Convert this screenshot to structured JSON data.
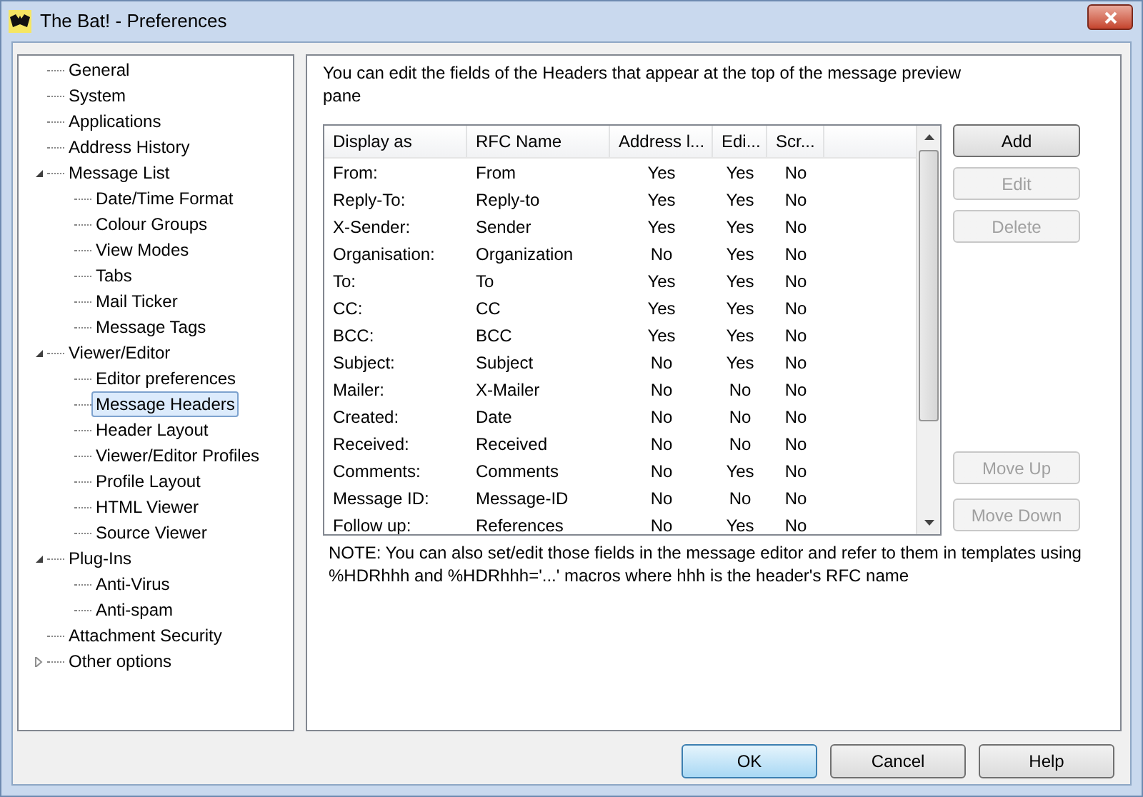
{
  "window": {
    "title": "The Bat! - Preferences"
  },
  "tree": [
    {
      "label": "General",
      "selected": false
    },
    {
      "label": "System",
      "selected": false
    },
    {
      "label": "Applications",
      "selected": false
    },
    {
      "label": "Address History",
      "selected": false
    },
    {
      "label": "Message List",
      "selected": false,
      "expanded": true,
      "children": [
        {
          "label": "Date/Time Format",
          "selected": false
        },
        {
          "label": "Colour Groups",
          "selected": false
        },
        {
          "label": "View Modes",
          "selected": false
        },
        {
          "label": "Tabs",
          "selected": false
        },
        {
          "label": "Mail Ticker",
          "selected": false
        },
        {
          "label": "Message Tags",
          "selected": false
        }
      ]
    },
    {
      "label": "Viewer/Editor",
      "selected": false,
      "expanded": true,
      "children": [
        {
          "label": "Editor preferences",
          "selected": false
        },
        {
          "label": "Message Headers",
          "selected": true
        },
        {
          "label": "Header Layout",
          "selected": false
        },
        {
          "label": "Viewer/Editor Profiles",
          "selected": false
        },
        {
          "label": "Profile Layout",
          "selected": false
        },
        {
          "label": "HTML Viewer",
          "selected": false
        },
        {
          "label": "Source Viewer",
          "selected": false
        }
      ]
    },
    {
      "label": "Plug-Ins",
      "selected": false,
      "expanded": true,
      "children": [
        {
          "label": "Anti-Virus",
          "selected": false
        },
        {
          "label": "Anti-spam",
          "selected": false
        }
      ]
    },
    {
      "label": "Attachment Security",
      "selected": false
    },
    {
      "label": "Other options",
      "selected": false,
      "expanded": false
    }
  ],
  "intro": "You can edit the fields of the Headers that appear at the top of the message preview pane",
  "table": {
    "columns": [
      "Display as",
      "RFC Name",
      "Address l...",
      "Edi...",
      "Scr..."
    ],
    "rows": [
      [
        "From:",
        "From",
        "Yes",
        "Yes",
        "No"
      ],
      [
        "Reply-To:",
        "Reply-to",
        "Yes",
        "Yes",
        "No"
      ],
      [
        "X-Sender:",
        "Sender",
        "Yes",
        "Yes",
        "No"
      ],
      [
        "Organisation:",
        "Organization",
        "No",
        "Yes",
        "No"
      ],
      [
        "To:",
        "To",
        "Yes",
        "Yes",
        "No"
      ],
      [
        "CC:",
        "CC",
        "Yes",
        "Yes",
        "No"
      ],
      [
        "BCC:",
        "BCC",
        "Yes",
        "Yes",
        "No"
      ],
      [
        "Subject:",
        "Subject",
        "No",
        "Yes",
        "No"
      ],
      [
        "Mailer:",
        "X-Mailer",
        "No",
        "No",
        "No"
      ],
      [
        "Created:",
        "Date",
        "No",
        "No",
        "No"
      ],
      [
        "Received:",
        "Received",
        "No",
        "No",
        "No"
      ],
      [
        "Comments:",
        "Comments",
        "No",
        "Yes",
        "No"
      ],
      [
        "Message ID:",
        "Message-ID",
        "No",
        "No",
        "No"
      ],
      [
        "Follow up:",
        "References",
        "No",
        "Yes",
        "No"
      ]
    ]
  },
  "edit_buttons": [
    {
      "label": "Add",
      "disabled": false
    },
    {
      "label": "Edit",
      "disabled": true
    },
    {
      "label": "Delete",
      "disabled": true
    }
  ],
  "move_buttons": [
    {
      "label": "Move Up",
      "disabled": true
    },
    {
      "label": "Move Down",
      "disabled": true
    }
  ],
  "note": "NOTE: You can also set/edit those fields in the message editor and refer to them in templates using %HDRhhh and %HDRhhh='...' macros where hhh is the header's RFC name",
  "buttons": [
    {
      "label": "OK",
      "default": true
    },
    {
      "label": "Cancel",
      "default": false
    },
    {
      "label": "Help",
      "default": false
    }
  ]
}
